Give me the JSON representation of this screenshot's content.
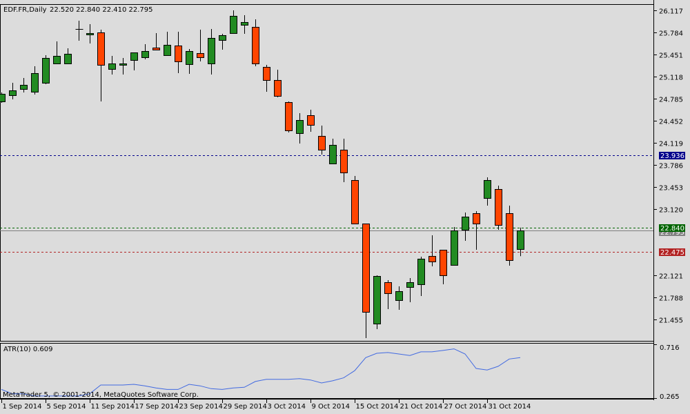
{
  "header": {
    "symbol": "EDF.FR,Daily",
    "ohlc": "22.520 22.840 22.410 22.795"
  },
  "colors": {
    "background": "#dcdcdc",
    "bull": "#228b22",
    "bear": "#ff4500",
    "level_line": "#00008b",
    "ask_line": "#006400",
    "bid_line": "#b22222",
    "last_line": "#808080",
    "atr_line": "#4169e1"
  },
  "price_axis": {
    "ticks": [
      "26.117",
      "25.784",
      "25.451",
      "25.118",
      "24.785",
      "24.452",
      "24.119",
      "23.786",
      "23.453",
      "23.120",
      "22.121",
      "21.788",
      "21.455"
    ]
  },
  "levels": {
    "horizontal": {
      "value": "23.936"
    },
    "ask": {
      "value": "22.840"
    },
    "last": {
      "value": "22.795"
    },
    "bid": {
      "value": "22.475"
    }
  },
  "indicator": {
    "label": "ATR(10) 0.609",
    "axis_max": "0.716",
    "axis_min": "0.265"
  },
  "copyright": "MetaTrader 5, © 2001-2014, MetaQuotes Software Corp.",
  "date_axis": [
    {
      "index": 0,
      "label": "1 Sep 2014"
    },
    {
      "index": 4,
      "label": "5 Sep 2014"
    },
    {
      "index": 8,
      "label": "11 Sep 2014"
    },
    {
      "index": 12,
      "label": "17 Sep 2014"
    },
    {
      "index": 16,
      "label": "23 Sep 2014"
    },
    {
      "index": 20,
      "label": "29 Sep 2014"
    },
    {
      "index": 24,
      "label": "3 Oct 2014"
    },
    {
      "index": 28,
      "label": "9 Oct 2014"
    },
    {
      "index": 32,
      "label": "15 Oct 2014"
    },
    {
      "index": 36,
      "label": "21 Oct 2014"
    },
    {
      "index": 40,
      "label": "27 Oct 2014"
    },
    {
      "index": 44,
      "label": "31 Oct 2014"
    }
  ],
  "chart_data": {
    "type": "candlestick",
    "title": "EDF.FR,Daily",
    "ylim": [
      21.455,
      26.117
    ],
    "ohlc": [
      [
        24.743,
        24.879,
        24.722,
        24.858
      ],
      [
        24.837,
        25.024,
        24.775,
        24.91
      ],
      [
        24.931,
        25.097,
        24.879,
        24.993
      ],
      [
        24.889,
        25.274,
        24.847,
        25.17
      ],
      [
        25.024,
        25.441,
        25.004,
        25.399
      ],
      [
        25.316,
        25.649,
        25.305,
        25.43
      ],
      [
        25.316,
        25.545,
        25.316,
        25.461
      ],
      [
        25.836,
        25.961,
        25.659,
        25.836
      ],
      [
        25.753,
        25.909,
        25.617,
        25.774
      ],
      [
        25.784,
        25.826,
        24.743,
        25.295
      ],
      [
        25.233,
        25.43,
        25.149,
        25.316
      ],
      [
        25.295,
        25.399,
        25.149,
        25.316
      ],
      [
        25.368,
        25.482,
        25.212,
        25.482
      ],
      [
        25.409,
        25.607,
        25.378,
        25.503
      ],
      [
        25.555,
        25.774,
        25.513,
        25.524
      ],
      [
        25.441,
        25.794,
        25.441,
        25.597
      ],
      [
        25.586,
        25.794,
        25.17,
        25.347
      ],
      [
        25.305,
        25.534,
        25.16,
        25.503
      ],
      [
        25.472,
        25.826,
        25.347,
        25.409
      ],
      [
        25.316,
        25.836,
        25.149,
        25.701
      ],
      [
        25.669,
        25.763,
        25.524,
        25.742
      ],
      [
        25.774,
        26.117,
        25.774,
        26.034
      ],
      [
        25.898,
        26.044,
        25.763,
        25.94
      ],
      [
        25.867,
        25.982,
        25.274,
        25.316
      ],
      [
        25.264,
        25.295,
        24.889,
        25.066
      ],
      [
        25.066,
        25.222,
        24.806,
        24.827
      ],
      [
        24.733,
        24.743,
        24.275,
        24.306
      ],
      [
        24.265,
        24.567,
        24.109,
        24.462
      ],
      [
        24.535,
        24.619,
        24.285,
        24.39
      ],
      [
        24.223,
        24.379,
        23.942,
        24.015
      ],
      [
        23.807,
        24.181,
        23.807,
        24.088
      ],
      [
        24.015,
        24.181,
        23.526,
        23.671
      ],
      [
        23.557,
        23.619,
        22.901,
        22.901
      ],
      [
        22.901,
        22.901,
        21.174,
        21.569
      ],
      [
        21.393,
        22.121,
        21.309,
        22.111
      ],
      [
        22.017,
        22.048,
        21.611,
        21.851
      ],
      [
        21.746,
        21.955,
        21.601,
        21.882
      ],
      [
        21.944,
        22.079,
        21.715,
        22.017
      ],
      [
        21.986,
        22.402,
        21.809,
        22.371
      ],
      [
        22.412,
        22.725,
        22.256,
        22.329
      ],
      [
        22.506,
        22.506,
        21.986,
        22.121
      ],
      [
        22.277,
        22.849,
        22.277,
        22.797
      ],
      [
        22.808,
        23.068,
        22.641,
        23.006
      ],
      [
        23.058,
        23.089,
        22.506,
        22.901
      ],
      [
        23.287,
        23.599,
        23.172,
        23.557
      ],
      [
        23.422,
        23.474,
        22.808,
        22.88
      ],
      [
        23.058,
        23.172,
        22.267,
        22.35
      ],
      [
        22.52,
        22.84,
        22.41,
        22.795
      ]
    ],
    "atr": {
      "name": "ATR(10)",
      "ylim": [
        0.265,
        0.716
      ],
      "values": [
        0.339,
        0.302,
        0.302,
        0.283,
        0.283,
        0.283,
        0.283,
        0.283,
        0.302,
        0.376,
        0.376,
        0.376,
        0.382,
        0.369,
        0.351,
        0.339,
        0.339,
        0.382,
        0.369,
        0.345,
        0.339,
        0.351,
        0.357,
        0.406,
        0.425,
        0.425,
        0.425,
        0.431,
        0.419,
        0.394,
        0.412,
        0.437,
        0.498,
        0.609,
        0.646,
        0.652,
        0.64,
        0.627,
        0.658,
        0.658,
        0.67,
        0.683,
        0.64,
        0.517,
        0.504,
        0.535,
        0.597,
        0.609
      ]
    }
  }
}
